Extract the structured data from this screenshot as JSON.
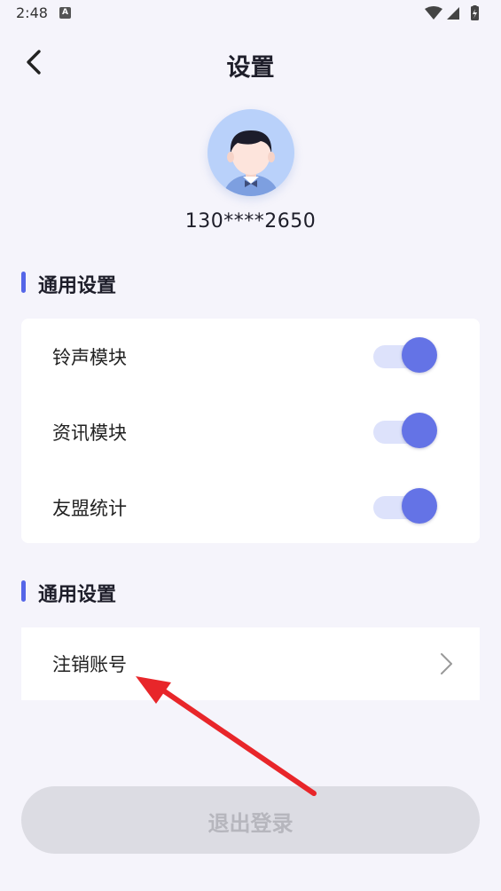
{
  "status_bar": {
    "time": "2:48",
    "notification_icon": "a-notification-icon",
    "icons": [
      "wifi-icon",
      "signal-icon",
      "battery-icon"
    ]
  },
  "header": {
    "title": "设置",
    "back_icon": "chevron-left-icon"
  },
  "profile": {
    "avatar_icon": "avatar-boy-icon",
    "phone": "130****2650"
  },
  "sections": [
    {
      "title": "通用设置",
      "items": [
        {
          "label": "铃声模块",
          "enabled": true
        },
        {
          "label": "资讯模块",
          "enabled": true
        },
        {
          "label": "友盟统计",
          "enabled": true
        }
      ]
    },
    {
      "title": "通用设置",
      "items": [
        {
          "label": "注销账号",
          "icon": "chevron-right-icon"
        }
      ]
    }
  ],
  "logout": {
    "label": "退出登录"
  },
  "colors": {
    "accent": "#6473e6",
    "background": "#f5f4fb",
    "annotation_arrow": "#e8262a"
  }
}
